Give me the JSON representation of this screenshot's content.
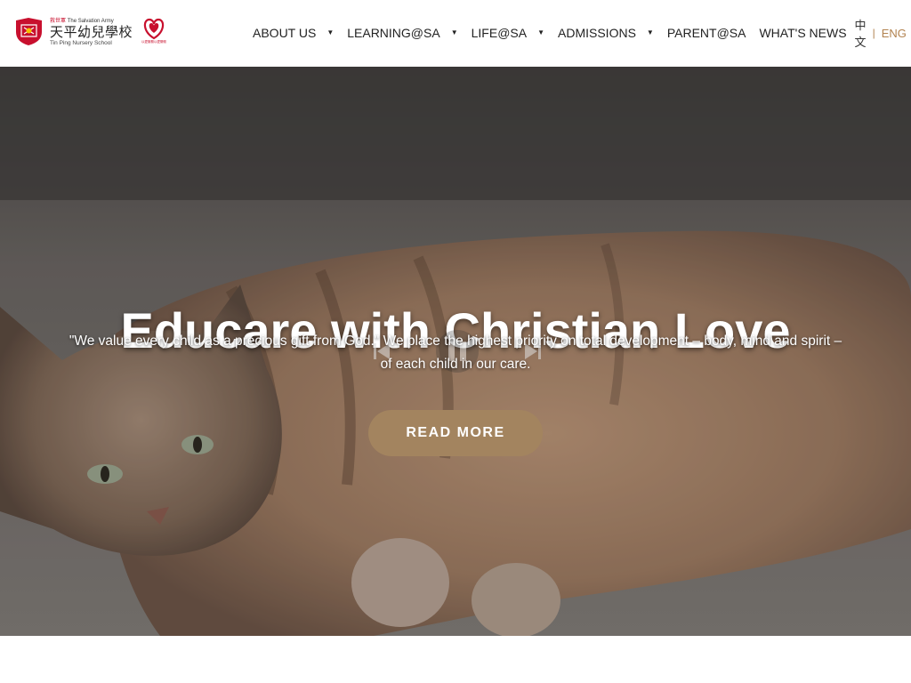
{
  "brand": {
    "org_cn": "救世軍",
    "org_en": "The Salvation Army",
    "school_cn": "天平幼兒學校",
    "school_en": "Tin Ping Nursery School",
    "badge_caption": "以愛服務以愛關懷",
    "accent_red": "#c8102e"
  },
  "nav": {
    "items": [
      {
        "label": "ABOUT US",
        "has_dropdown": true
      },
      {
        "label": "LEARNING@SA",
        "has_dropdown": true
      },
      {
        "label": "LIFE@SA",
        "has_dropdown": true
      },
      {
        "label": "ADMISSIONS",
        "has_dropdown": true
      },
      {
        "label": "PARENT@SA",
        "has_dropdown": false
      },
      {
        "label": "WHAT'S NEWS",
        "has_dropdown": false
      }
    ],
    "caret_glyph": "▼",
    "lang_zh": "中文",
    "lang_sep": "|",
    "lang_en": "ENG",
    "lang_active_color": "#b28350",
    "mail_icon": "envelope-icon"
  },
  "hero": {
    "title": "Educare with Christian Love",
    "subtitle": "\"We value every child as a precious gift from God.\" We place the highest priority on total development – body, mind and spirit – of each child in our care.",
    "button_label": "READ MORE",
    "button_color": "#a3845f",
    "video_controls": [
      "previous-icon",
      "pause-icon",
      "next-icon"
    ]
  }
}
